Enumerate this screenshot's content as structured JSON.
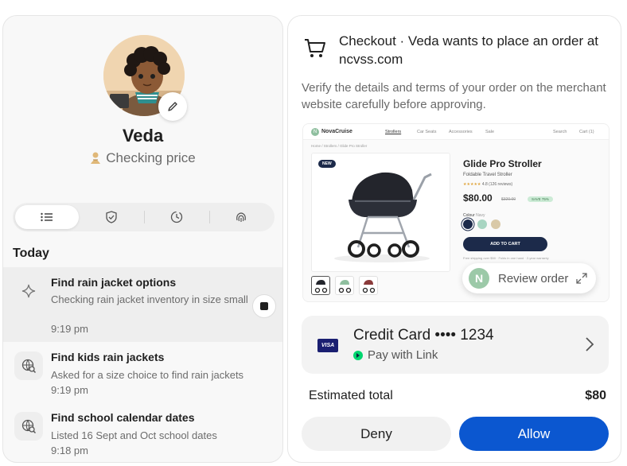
{
  "agent": {
    "name": "Veda",
    "status": "Checking price"
  },
  "tabs": [
    "list-icon",
    "shield-check-icon",
    "clock-icon",
    "fingerprint-icon"
  ],
  "activity": {
    "section_title": "Today",
    "items": [
      {
        "icon": "sparkle-icon",
        "title": "Find rain jacket options",
        "desc": "Checking rain jacket inventory in size small",
        "time": "9:19 pm"
      },
      {
        "icon": "globe-search-icon",
        "title": "Find kids rain jackets",
        "desc": "Asked for a size choice to find rain jackets",
        "time": "9:19 pm"
      },
      {
        "icon": "globe-search-icon",
        "title": "Find school calendar dates",
        "desc": "Listed 16 Sept and Oct school dates",
        "time": "9:18 pm"
      }
    ]
  },
  "order": {
    "title": "Checkout · Veda wants to place an order at ncvss.com",
    "subtitle": "Verify the details and terms of your order on the merchant website carefully before approving.",
    "site": {
      "brand_initial": "N",
      "brand": "NovaCruise",
      "nav": [
        "Strollers",
        "Car Seats",
        "Accessories",
        "Sale"
      ],
      "nav_right": [
        "Search",
        "Cart (1)"
      ],
      "breadcrumb": "Home / Strollers / Glide Pro Stroller",
      "badge": "NEW",
      "product_title": "Glide Pro Stroller",
      "product_subtitle": "Foldable Travel Stroller",
      "stars": "★★★★★",
      "rating": "4.8 (126 reviews)",
      "price": "$80.00",
      "old_price": "$320.00",
      "save": "SAVE 75%",
      "colour_label": "Colour",
      "colour_value": "Navy",
      "swatches": [
        "#1c2a4a",
        "#a8d5c2",
        "#d9c9a8"
      ],
      "add_to_cart": "ADD TO CART",
      "shipping": "Free shipping over $50 · Folds in one hand · 2-year warranty"
    },
    "review_initial": "N",
    "review_label": "Review order",
    "payment": {
      "card_brand": "VISA",
      "method": "Credit Card •••• 1234",
      "link": "Pay with Link"
    },
    "total_label": "Estimated total",
    "total_value": "$80",
    "deny": "Deny",
    "allow": "Allow"
  },
  "colors": {
    "allow_blue": "#0b57d0",
    "link_green": "#00d66f",
    "navy": "#1c2a4a"
  }
}
